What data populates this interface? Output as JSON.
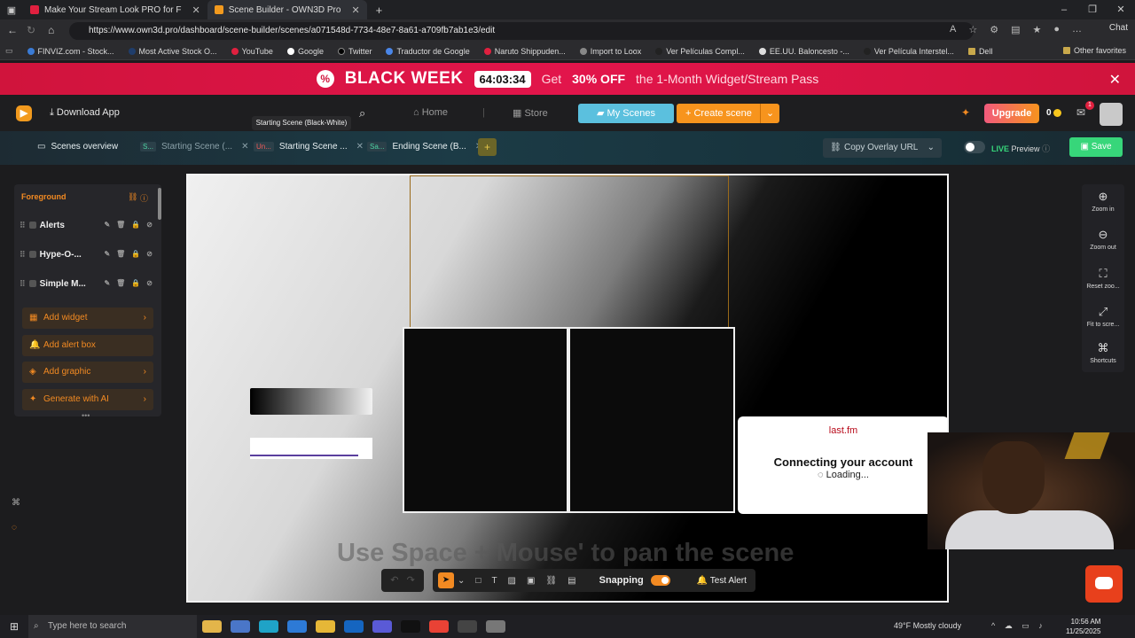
{
  "browser": {
    "tabs": [
      {
        "title": "Make Your Stream Look PRO for F"
      },
      {
        "title": "Scene Builder - OWN3D Pro"
      }
    ],
    "url": "https://www.own3d.pro/dashboard/scene-builder/scenes/a071548d-7734-48e7-8a61-a709fb7ab1e3/edit",
    "chat_label": "Chat",
    "favorites": [
      "FINVIZ.com - Stock...",
      "Most Active Stock O...",
      "YouTube",
      "Google",
      "Twitter",
      "Traductor de Google",
      "Naruto Shippuden...",
      "Import to Loox",
      "Ver Películas Compl...",
      "EE.UU. Baloncesto -...",
      "Ver Película Interstel...",
      "Dell"
    ],
    "other_favorites": "Other favorites"
  },
  "promo": {
    "title": "BLACK WEEK",
    "timer": "64:03:34",
    "get": "Get",
    "off": "30% OFF",
    "rest": "the 1-Month Widget/Stream Pass"
  },
  "header": {
    "download": "Download App",
    "home": "Home",
    "store": "Store",
    "my_scenes": "My Scenes",
    "create_scene": "Create scene",
    "upgrade": "Upgrade",
    "coins": "0",
    "notifications": "1"
  },
  "tooltip": "Starting Scene (Black-White)",
  "scene_tabs": {
    "overview": "Scenes overview",
    "tabs": [
      {
        "badge": "S...",
        "label": "Starting Scene (..."
      },
      {
        "badge": "Un...",
        "label": "Starting Scene ..."
      },
      {
        "badge": "Sa...",
        "label": "Ending Scene (B..."
      }
    ],
    "copy_url": "Copy Overlay URL",
    "live_preview": "LIVE",
    "live_preview_rest": "Preview",
    "save": "Save"
  },
  "left_panel": {
    "title": "Foreground",
    "layers": [
      "Alerts",
      "Hype-O-...",
      "Simple M..."
    ],
    "buttons": [
      "Add widget",
      "Add alert box",
      "Add graphic",
      "Generate with AI"
    ]
  },
  "canvas": {
    "lastfm_logo": "last.fm",
    "lastfm_title": "Connecting your account",
    "lastfm_loading": "Loading...",
    "pan_hint": "Use Space + Mouse' to pan the scene"
  },
  "toolbar": {
    "snapping": "Snapping",
    "test_alert": "Test Alert"
  },
  "zoom_panel": [
    "Zoom in",
    "Zoom out",
    "Reset zoo...",
    "Fit to scre...",
    "Shortcuts"
  ],
  "taskbar": {
    "search": "Type here to search",
    "weather": "49°F  Mostly cloudy",
    "time": "10:56 AM",
    "date": "11/25/2025"
  }
}
